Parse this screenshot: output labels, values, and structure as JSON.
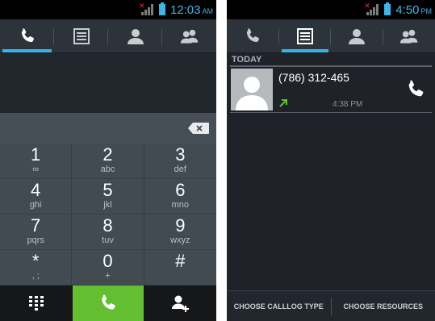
{
  "colors": {
    "accent": "#33b5e5",
    "call_green": "#63bf2f"
  },
  "left": {
    "status": {
      "time": "12:03",
      "ampm": "AM"
    },
    "tabs": [
      {
        "icon": "phone-icon",
        "active": true
      },
      {
        "icon": "call-log-icon",
        "active": false
      },
      {
        "icon": "contact-icon",
        "active": false
      },
      {
        "icon": "contacts-group-icon",
        "active": false
      }
    ],
    "keys": [
      {
        "num": "1",
        "letters": "∞"
      },
      {
        "num": "2",
        "letters": "abc"
      },
      {
        "num": "3",
        "letters": "def"
      },
      {
        "num": "4",
        "letters": "ghi"
      },
      {
        "num": "5",
        "letters": "jkl"
      },
      {
        "num": "6",
        "letters": "mno"
      },
      {
        "num": "7",
        "letters": "pqrs"
      },
      {
        "num": "8",
        "letters": "tuv"
      },
      {
        "num": "9",
        "letters": "wxyz"
      },
      {
        "num": "*",
        "letters": ", ;"
      },
      {
        "num": "0",
        "letters": "+"
      },
      {
        "num": "#",
        "letters": ""
      }
    ]
  },
  "right": {
    "status": {
      "time": "4:50",
      "ampm": "PM"
    },
    "section_header": "TODAY",
    "log": [
      {
        "number": "(786) 312-465",
        "time": "4:38 PM"
      }
    ],
    "bottom": {
      "left_label": "CHOOSE CALLLOG TYPE",
      "right_label": "CHOOSE RESOURCES"
    }
  }
}
